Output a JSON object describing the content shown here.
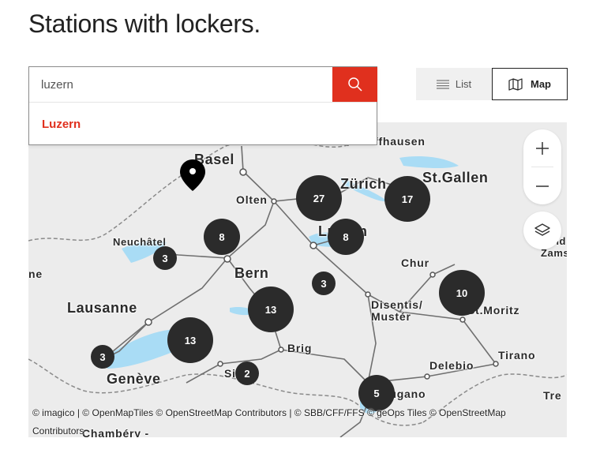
{
  "page": {
    "title": "Stations with lockers."
  },
  "search": {
    "value": "luzern",
    "placeholder": "",
    "suggestions": [
      "Luzern"
    ]
  },
  "view_toggle": {
    "list_label": "List",
    "map_label": "Map",
    "active": "Map"
  },
  "map": {
    "cities": [
      {
        "name": "Basel"
      },
      {
        "name": "Zürich"
      },
      {
        "name": "St.Gallen"
      },
      {
        "name": "Olten"
      },
      {
        "name": "Luzern"
      },
      {
        "name": "Neuchâtel"
      },
      {
        "name": "Bern"
      },
      {
        "name": "Chur"
      },
      {
        "name": "Lausanne"
      },
      {
        "name": "Disentis/"
      },
      {
        "name": "Mustér"
      },
      {
        "name": "St.Moritz"
      },
      {
        "name": "Brig"
      },
      {
        "name": "Genève"
      },
      {
        "name": "Sion"
      },
      {
        "name": "Tirano"
      },
      {
        "name": "Delebio"
      },
      {
        "name": "Lugano"
      },
      {
        "name": "ffhausen"
      },
      {
        "name": "Chambéry -"
      },
      {
        "name": "ne"
      },
      {
        "name": "Tre"
      },
      {
        "name": "Zams"
      },
      {
        "name": "nd"
      }
    ],
    "clusters": [
      "27",
      "17",
      "8",
      "8",
      "3",
      "3",
      "13",
      "10",
      "13",
      "3",
      "2",
      "5"
    ],
    "attribution_line1": "© imagico | © OpenMapTiles © OpenStreetMap Contributors | © SBB/CFF/FFS © geOps Tiles © OpenStreetMap",
    "attribution_line2": "Contributors"
  },
  "colors": {
    "accent": "#e0301e",
    "cluster": "#2b2b2b",
    "lake": "#a9dcf5",
    "map_bg": "#eceded"
  }
}
